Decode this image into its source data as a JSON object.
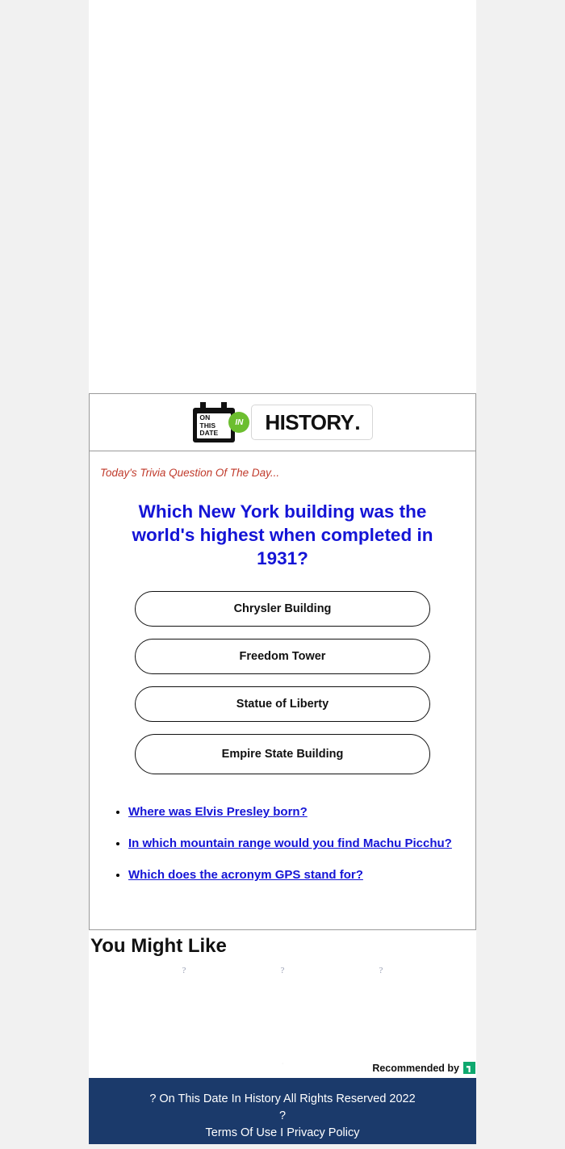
{
  "site": {
    "logo": {
      "calendar_lines": [
        "ON",
        "THIS",
        "DATE"
      ],
      "in_badge": "IN",
      "wordmark": "HISTORY",
      "wordmark_dot": ".",
      "accent_green": "#6cbe2f"
    }
  },
  "quiz": {
    "kicker": "Today's Trivia Question Of The Day...",
    "question": "Which New York building was the world's highest when completed in 1931?",
    "answers": [
      "Chrysler Building",
      "Freedom Tower",
      "Statue of Liberty",
      "Empire State Building"
    ],
    "link_color": "#1414d6",
    "kicker_color": "#c03a2b"
  },
  "related_questions": [
    "Where was Elvis Presley born?",
    "In which mountain range would you find Machu Picchu?",
    "Which does the acronym GPS stand for?"
  ],
  "recommendations": {
    "heading": "You Might Like",
    "items": [
      {
        "placeholder": "?"
      },
      {
        "placeholder": "?"
      },
      {
        "placeholder": "?"
      }
    ],
    "separator_dot": "·",
    "attribution_label": "Recommended by",
    "attribution_badge": "┓",
    "attribution_badge_color": "#0ea86e"
  },
  "footer": {
    "copyright": "? On This Date In History All Rights Reserved 2022",
    "mark": "?",
    "terms": "Terms Of Use",
    "divider": "I",
    "privacy": "Privacy Policy",
    "background": "#1b3a6b"
  }
}
